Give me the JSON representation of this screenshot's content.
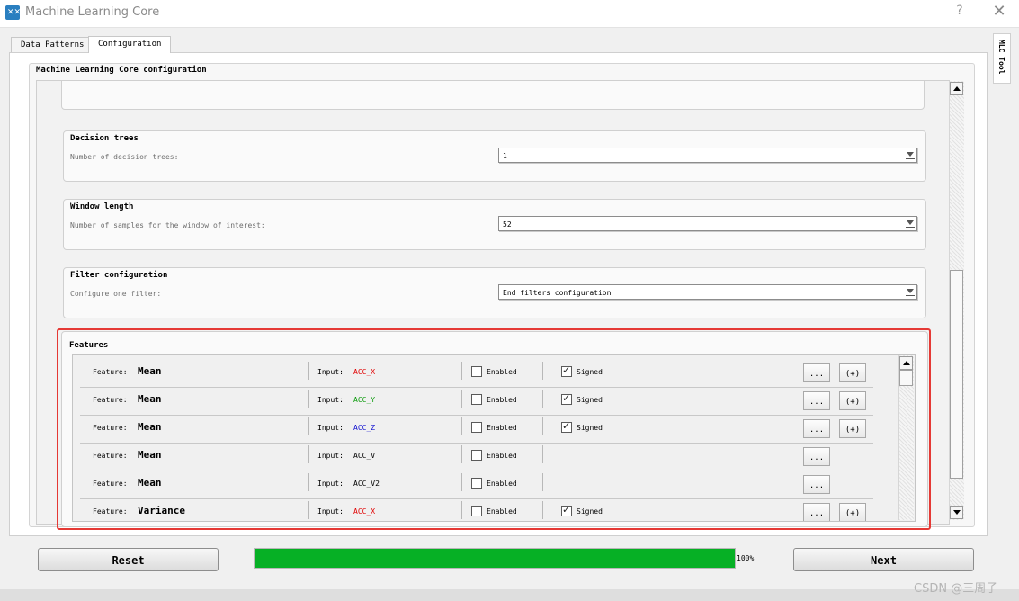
{
  "window": {
    "title": "Machine Learning Core",
    "help_label": "?",
    "close_label": "✕",
    "icon": "app-logo-icon"
  },
  "tabs": [
    {
      "label": "Data Patterns",
      "active": false
    },
    {
      "label": "Configuration",
      "active": true
    }
  ],
  "side_tab": {
    "label": "MLC Tool"
  },
  "config": {
    "title": "Machine Learning Core configuration",
    "decision_trees": {
      "title": "Decision trees",
      "desc": "Number of decision trees:",
      "value": "1"
    },
    "window_length": {
      "title": "Window length",
      "desc": "Number of samples for the window of interest:",
      "value": "52"
    },
    "filter": {
      "title": "Filter configuration",
      "desc": "Configure one filter:",
      "value": "End filters configuration"
    }
  },
  "features": {
    "title": "Features",
    "feature_label": "Feature:",
    "input_label": "Input:",
    "enabled_label": "Enabled",
    "signed_label": "Signed",
    "more_label": "...",
    "add_label": "(+)",
    "rows": [
      {
        "name": "Mean",
        "input": "ACC_X",
        "input_color": "#e00000",
        "enabled": false,
        "has_signed": true,
        "signed": true,
        "has_add": true
      },
      {
        "name": "Mean",
        "input": "ACC_Y",
        "input_color": "#0a9a0a",
        "enabled": false,
        "has_signed": true,
        "signed": true,
        "has_add": true
      },
      {
        "name": "Mean",
        "input": "ACC_Z",
        "input_color": "#1010d0",
        "enabled": false,
        "has_signed": true,
        "signed": true,
        "has_add": true
      },
      {
        "name": "Mean",
        "input": "ACC_V",
        "input_color": "#000000",
        "enabled": false,
        "has_signed": false,
        "signed": false,
        "has_add": false
      },
      {
        "name": "Mean",
        "input": "ACC_V2",
        "input_color": "#000000",
        "enabled": false,
        "has_signed": false,
        "signed": false,
        "has_add": false
      },
      {
        "name": "Variance",
        "input": "ACC_X",
        "input_color": "#e00000",
        "enabled": false,
        "has_signed": true,
        "signed": true,
        "has_add": true
      }
    ]
  },
  "bottom": {
    "reset_label": "Reset",
    "next_label": "Next",
    "progress_percent": 100,
    "progress_text": "100%"
  },
  "watermark": "CSDN @三周子",
  "colors": {
    "progress": "#06b025",
    "highlight": "#e53935"
  }
}
